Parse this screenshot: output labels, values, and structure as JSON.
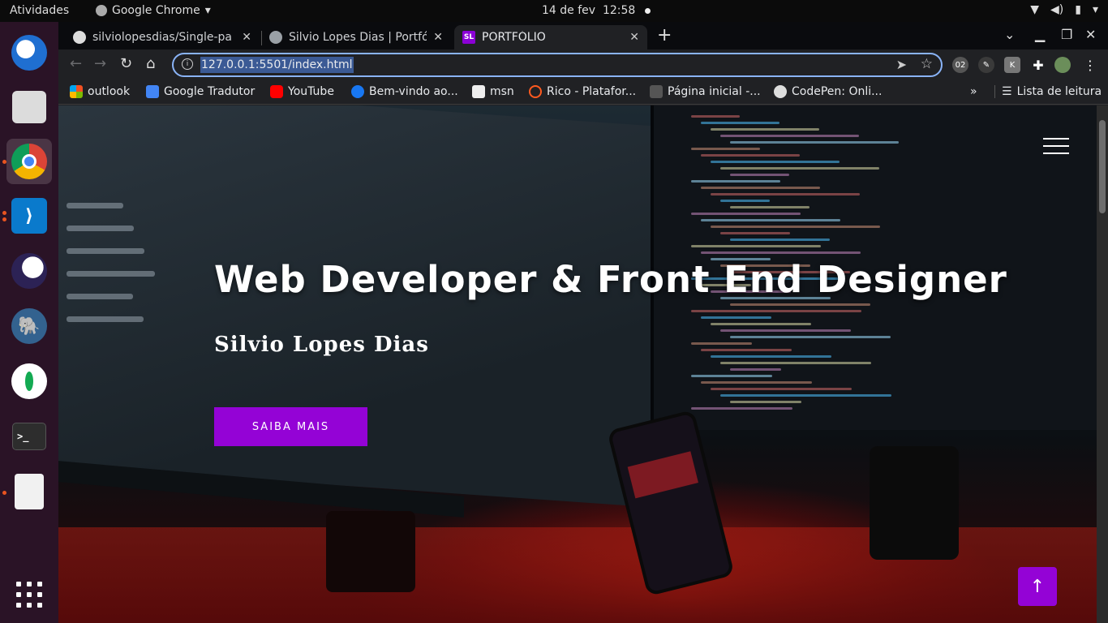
{
  "topbar": {
    "activities": "Atividades",
    "app_name": "Google Chrome",
    "date": "14 de fev",
    "time": "12:58"
  },
  "dock": {
    "items": [
      {
        "name": "thunderbird",
        "icon": "thunderbird-icon"
      },
      {
        "name": "files",
        "icon": "files-icon"
      },
      {
        "name": "google-chrome",
        "icon": "chrome-icon"
      },
      {
        "name": "vscode",
        "icon": "vscode-icon"
      },
      {
        "name": "eclipse",
        "icon": "eclipse-icon"
      },
      {
        "name": "postgres",
        "icon": "elephant-icon"
      },
      {
        "name": "mongodb",
        "icon": "mongodb-icon"
      },
      {
        "name": "terminal",
        "icon": "terminal-icon"
      },
      {
        "name": "document-viewer",
        "icon": "document-viewer-icon"
      }
    ],
    "terminal_prompt": ">_"
  },
  "tabs": [
    {
      "title": "silviolopesdias/Single-pa",
      "favicon": "github-icon"
    },
    {
      "title": "Silvio Lopes Dias | Portfól",
      "favicon": "globe-icon"
    },
    {
      "title": "PORTFÓLIO",
      "favicon": "sl-logo-icon",
      "favicon_text": "SL",
      "active": true
    }
  ],
  "address_bar": {
    "url": "127.0.0.1:5501/index.html"
  },
  "bookmarks": [
    {
      "label": "outlook",
      "icon": "microsoft-icon",
      "color": "#f25022"
    },
    {
      "label": "Google Tradutor",
      "icon": "translate-icon",
      "color": "#4285f4"
    },
    {
      "label": "YouTube",
      "icon": "youtube-icon",
      "color": "#ff0000"
    },
    {
      "label": "Bem-vindo ao...",
      "icon": "facebook-icon",
      "color": "#1877f2"
    },
    {
      "label": "msn",
      "icon": "msn-icon",
      "color": "#ffffff"
    },
    {
      "label": "Rico - Platafor...",
      "icon": "rico-icon",
      "color": "#ff5a1f"
    },
    {
      "label": "Página inicial -...",
      "icon": "page-icon",
      "color": "#555555"
    },
    {
      "label": "CodePen: Onli...",
      "icon": "codepen-icon",
      "color": "#dddddd"
    }
  ],
  "reading_list": "Lista de leitura",
  "extensions": {
    "ext1_text": "02"
  },
  "hero": {
    "title": "Web Developer & Front End Designer",
    "name": "Silvio Lopes Dias",
    "cta": "SAIBA MAIS"
  },
  "colors": {
    "accent": "#9403d6",
    "omnibox_focus": "#8ab4f8",
    "dock_bg": "#2a1326"
  }
}
